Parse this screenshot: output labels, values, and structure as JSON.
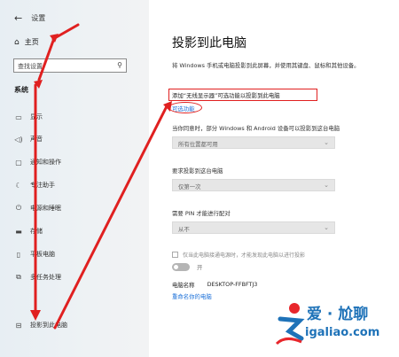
{
  "sidebar": {
    "title": "设置",
    "home": "主页",
    "search_placeholder": "查找设置",
    "section": "系统",
    "items": [
      {
        "label": "显示",
        "icon": "monitor-icon"
      },
      {
        "label": "声音",
        "icon": "speaker-icon"
      },
      {
        "label": "通知和操作",
        "icon": "notification-icon"
      },
      {
        "label": "专注助手",
        "icon": "moon-icon"
      },
      {
        "label": "电源和睡眠",
        "icon": "power-icon"
      },
      {
        "label": "存储",
        "icon": "storage-icon"
      },
      {
        "label": "平板电脑",
        "icon": "tablet-icon"
      },
      {
        "label": "多任务处理",
        "icon": "multitask-icon"
      },
      {
        "label": "投影到此电脑",
        "icon": "project-icon"
      }
    ]
  },
  "main": {
    "title": "投影到此电脑",
    "intro": "将 Windows 手机或电脑投影到此屏幕，并使用其键盘、鼠标和其他设备。",
    "highlight": "添加“无线显示器”可选功能以投影到此电脑",
    "optional_link": "可选功能",
    "setting1_label": "当你同意时，部分 Windows 和 Android 设备可以投影到这台电脑",
    "setting1_value": "所有位置都可用",
    "setting2_label": "要求投影到这台电脑",
    "setting2_value": "仅第一次",
    "setting3_label": "需要 PIN 才能进行配对",
    "setting3_value": "从不",
    "checkbox_label": "仅当此电脑接通电源时，才能发现此电脑以进行投影",
    "toggle_label": "开",
    "pc_name_label": "电脑名称",
    "pc_name_value": "DESKTOP-FFBFTJ3",
    "rename_link": "重命名你的电脑"
  },
  "watermark": {
    "brand": "爱 · 尬聊",
    "url": "igaliao.com"
  },
  "colors": {
    "annotation_red": "#e02020",
    "link_blue": "#1a6fd8",
    "watermark_blue": "#1e72b8"
  }
}
